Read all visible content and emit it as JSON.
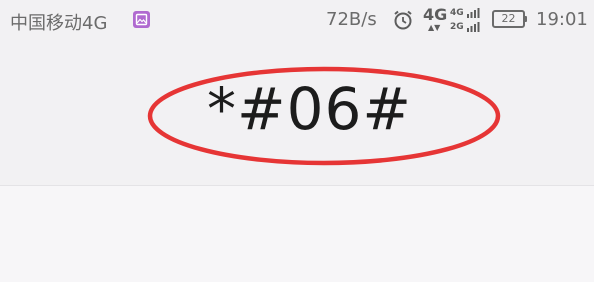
{
  "status_bar": {
    "carrier": "中国移动4G",
    "gallery_icon": "gallery-icon",
    "net_speed": "72B/s",
    "alarm_icon": "alarm-clock-icon",
    "network_type": "4G",
    "signal_labels": [
      "4G",
      "2G"
    ],
    "battery_level": "22",
    "time": "19:01"
  },
  "dialer": {
    "input_value": "*#06#"
  },
  "annotation": {
    "oval_color": "#e63535"
  }
}
